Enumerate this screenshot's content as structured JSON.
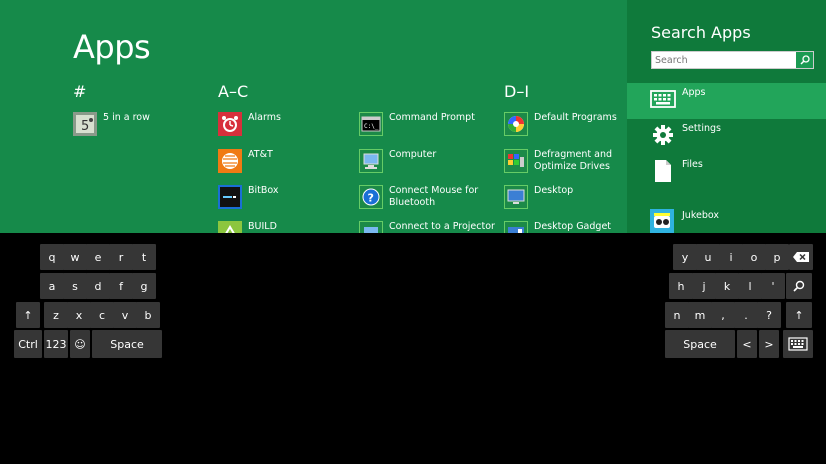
{
  "start": {
    "title": "Apps",
    "groups": [
      {
        "label": "#"
      },
      {
        "label": "A–C"
      },
      {
        "label": "D–I"
      }
    ],
    "apps": [
      {
        "label": "5 in a row",
        "icon": "five-in-a-row-icon"
      },
      {
        "label": "Alarms",
        "icon": "alarm-clock-icon"
      },
      {
        "label": "AT&T",
        "icon": "att-globe-icon"
      },
      {
        "label": "BitBox",
        "icon": "bitbox-icon"
      },
      {
        "label": "BUILD",
        "icon": "build-icon"
      },
      {
        "label": "Command Prompt",
        "icon": "command-prompt-icon"
      },
      {
        "label": "Computer",
        "icon": "computer-icon"
      },
      {
        "label": "Connect Mouse for Bluetooth",
        "icon": "help-icon"
      },
      {
        "label": "Connect to a Projector",
        "icon": "projector-icon"
      },
      {
        "label": "Default Programs",
        "icon": "default-programs-icon"
      },
      {
        "label": "Defragment and Optimize Drives",
        "icon": "defrag-icon"
      },
      {
        "label": "Desktop",
        "icon": "desktop-icon"
      },
      {
        "label": "Desktop Gadget",
        "icon": "gadget-icon"
      }
    ]
  },
  "charm": {
    "title": "Search Apps",
    "search_placeholder": "Search",
    "categories": [
      {
        "label": "Apps",
        "selected": true,
        "icon": "keyboard-icon"
      },
      {
        "label": "Settings",
        "selected": false,
        "icon": "gear-icon"
      },
      {
        "label": "Files",
        "selected": false,
        "icon": "file-icon"
      },
      {
        "label": "Jukebox",
        "selected": false,
        "icon": "jukebox-icon"
      }
    ]
  },
  "keyboard": {
    "left": {
      "row1": [
        "q",
        "w",
        "e",
        "r",
        "t"
      ],
      "row2": [
        "a",
        "s",
        "d",
        "f",
        "g"
      ],
      "row3": [
        "↑",
        "z",
        "x",
        "c",
        "v",
        "b"
      ],
      "ctrl": "Ctrl",
      "num": "123",
      "emoji": "☺",
      "space": "Space"
    },
    "right": {
      "row1": [
        "y",
        "u",
        "i",
        "o",
        "p"
      ],
      "row2": [
        "h",
        "j",
        "k",
        "l",
        "'"
      ],
      "row3": [
        "n",
        "m",
        ",",
        ".",
        "?",
        "↑"
      ],
      "space": "Space",
      "left_arrow": "<",
      "right_arrow": ">"
    }
  },
  "colors": {
    "start_bg": "#168a4a",
    "charm_bg": "#0f7a3b",
    "selected": "#22a55a",
    "key": "#363636"
  }
}
